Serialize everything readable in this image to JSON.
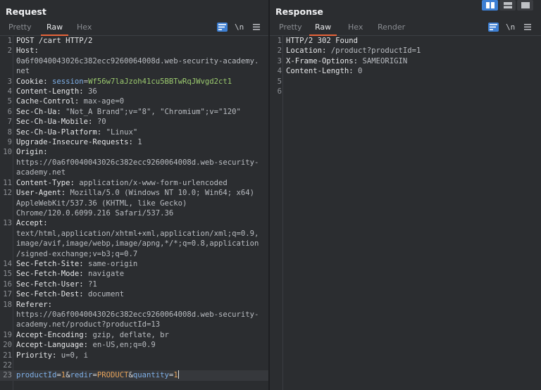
{
  "request": {
    "title": "Request",
    "tabs": [
      "Pretty",
      "Raw",
      "Hex"
    ],
    "active_tab": "Raw",
    "tools": {
      "newline": "\\n"
    },
    "lines": [
      {
        "n": "1",
        "parts": [
          {
            "t": "POST /cart HTTP/2",
            "c": "hname"
          }
        ]
      },
      {
        "n": "2",
        "parts": [
          {
            "t": "Host:",
            "c": "hname"
          }
        ]
      },
      {
        "n": "",
        "parts": [
          {
            "t": "0a6f0040043026c382ecc9260064008d.web-security-academy.",
            "c": "hval"
          }
        ]
      },
      {
        "n": "",
        "parts": [
          {
            "t": "net",
            "c": "hval"
          }
        ]
      },
      {
        "n": "3",
        "parts": [
          {
            "t": "Cookie: ",
            "c": "hname"
          },
          {
            "t": "session",
            "c": "cookie-name"
          },
          {
            "t": "=",
            "c": "hval"
          },
          {
            "t": "Wf56w7laJzoh41cu5BBTwRqJWvgd2ct1",
            "c": "cookie-val"
          }
        ]
      },
      {
        "n": "4",
        "parts": [
          {
            "t": "Content-Length:",
            "c": "hname"
          },
          {
            "t": " 36",
            "c": "hval"
          }
        ]
      },
      {
        "n": "5",
        "parts": [
          {
            "t": "Cache-Control:",
            "c": "hname"
          },
          {
            "t": " max-age=0",
            "c": "hval"
          }
        ]
      },
      {
        "n": "6",
        "parts": [
          {
            "t": "Sec-Ch-Ua:",
            "c": "hname"
          },
          {
            "t": " \"Not_A Brand\";v=\"8\", \"Chromium\";v=\"120\"",
            "c": "hval"
          }
        ]
      },
      {
        "n": "7",
        "parts": [
          {
            "t": "Sec-Ch-Ua-Mobile:",
            "c": "hname"
          },
          {
            "t": " ?0",
            "c": "hval"
          }
        ]
      },
      {
        "n": "8",
        "parts": [
          {
            "t": "Sec-Ch-Ua-Platform:",
            "c": "hname"
          },
          {
            "t": " \"Linux\"",
            "c": "hval"
          }
        ]
      },
      {
        "n": "9",
        "parts": [
          {
            "t": "Upgrade-Insecure-Requests:",
            "c": "hname"
          },
          {
            "t": " 1",
            "c": "hval"
          }
        ]
      },
      {
        "n": "10",
        "parts": [
          {
            "t": "Origin:",
            "c": "hname"
          }
        ]
      },
      {
        "n": "",
        "parts": [
          {
            "t": "https://0a6f0040043026c382ecc9260064008d.web-security-",
            "c": "hval"
          }
        ]
      },
      {
        "n": "",
        "parts": [
          {
            "t": "academy.net",
            "c": "hval"
          }
        ]
      },
      {
        "n": "11",
        "parts": [
          {
            "t": "Content-Type:",
            "c": "hname"
          },
          {
            "t": " application/x-www-form-urlencoded",
            "c": "hval"
          }
        ]
      },
      {
        "n": "12",
        "parts": [
          {
            "t": "User-Agent:",
            "c": "hname"
          },
          {
            "t": " Mozilla/5.0 (Windows NT 10.0; Win64; x64)",
            "c": "hval"
          }
        ]
      },
      {
        "n": "",
        "parts": [
          {
            "t": "AppleWebKit/537.36 (KHTML, like Gecko)",
            "c": "hval"
          }
        ]
      },
      {
        "n": "",
        "parts": [
          {
            "t": "Chrome/120.0.6099.216 Safari/537.36",
            "c": "hval"
          }
        ]
      },
      {
        "n": "13",
        "parts": [
          {
            "t": "Accept:",
            "c": "hname"
          }
        ]
      },
      {
        "n": "",
        "parts": [
          {
            "t": "text/html,application/xhtml+xml,application/xml;q=0.9,",
            "c": "hval"
          }
        ]
      },
      {
        "n": "",
        "parts": [
          {
            "t": "image/avif,image/webp,image/apng,*/*;q=0.8,application",
            "c": "hval"
          }
        ]
      },
      {
        "n": "",
        "parts": [
          {
            "t": "/signed-exchange;v=b3;q=0.7",
            "c": "hval"
          }
        ]
      },
      {
        "n": "14",
        "parts": [
          {
            "t": "Sec-Fetch-Site:",
            "c": "hname"
          },
          {
            "t": " same-origin",
            "c": "hval"
          }
        ]
      },
      {
        "n": "15",
        "parts": [
          {
            "t": "Sec-Fetch-Mode:",
            "c": "hname"
          },
          {
            "t": " navigate",
            "c": "hval"
          }
        ]
      },
      {
        "n": "16",
        "parts": [
          {
            "t": "Sec-Fetch-User:",
            "c": "hname"
          },
          {
            "t": " ?1",
            "c": "hval"
          }
        ]
      },
      {
        "n": "17",
        "parts": [
          {
            "t": "Sec-Fetch-Dest:",
            "c": "hname"
          },
          {
            "t": " document",
            "c": "hval"
          }
        ]
      },
      {
        "n": "18",
        "parts": [
          {
            "t": "Referer:",
            "c": "hname"
          }
        ]
      },
      {
        "n": "",
        "parts": [
          {
            "t": "https://0a6f0040043026c382ecc9260064008d.web-security-",
            "c": "hval"
          }
        ]
      },
      {
        "n": "",
        "parts": [
          {
            "t": "academy.net/product?productId=13",
            "c": "hval"
          }
        ]
      },
      {
        "n": "19",
        "parts": [
          {
            "t": "Accept-Encoding:",
            "c": "hname"
          },
          {
            "t": " gzip, deflate, br",
            "c": "hval"
          }
        ]
      },
      {
        "n": "20",
        "parts": [
          {
            "t": "Accept-Language:",
            "c": "hname"
          },
          {
            "t": " en-US,en;q=0.9",
            "c": "hval"
          }
        ]
      },
      {
        "n": "21",
        "parts": [
          {
            "t": "Priority:",
            "c": "hname"
          },
          {
            "t": " u=0, i",
            "c": "hval"
          }
        ]
      },
      {
        "n": "22",
        "parts": []
      },
      {
        "n": "23",
        "cursor": true,
        "parts": [
          {
            "t": "productId",
            "c": "param-name"
          },
          {
            "t": "=",
            "c": "amp"
          },
          {
            "t": "1",
            "c": "param-val"
          },
          {
            "t": "&",
            "c": "amp"
          },
          {
            "t": "redir",
            "c": "param-name"
          },
          {
            "t": "=",
            "c": "amp"
          },
          {
            "t": "PRODUCT",
            "c": "param-val"
          },
          {
            "t": "&",
            "c": "amp"
          },
          {
            "t": "quantity",
            "c": "param-name"
          },
          {
            "t": "=",
            "c": "amp"
          },
          {
            "t": "1",
            "c": "param-val"
          }
        ]
      }
    ]
  },
  "response": {
    "title": "Response",
    "tabs": [
      "Pretty",
      "Raw",
      "Hex",
      "Render"
    ],
    "active_tab": "Raw",
    "tools": {
      "newline": "\\n"
    },
    "lines": [
      {
        "n": "1",
        "parts": [
          {
            "t": "HTTP/2 302 Found",
            "c": "hname"
          }
        ]
      },
      {
        "n": "2",
        "parts": [
          {
            "t": "Location:",
            "c": "hname"
          },
          {
            "t": " /product?productId=1",
            "c": "hval"
          }
        ]
      },
      {
        "n": "3",
        "parts": [
          {
            "t": "X-Frame-Options:",
            "c": "hname"
          },
          {
            "t": " SAMEORIGIN",
            "c": "hval"
          }
        ]
      },
      {
        "n": "4",
        "parts": [
          {
            "t": "Content-Length:",
            "c": "hname"
          },
          {
            "t": " 0",
            "c": "hval"
          }
        ]
      },
      {
        "n": "5",
        "parts": []
      },
      {
        "n": "6",
        "parts": []
      }
    ]
  },
  "colors": {
    "accent_tab": "#e8643a",
    "tool_active": "#3d7fd3"
  },
  "icons": [
    "word-wrap-icon",
    "newline-icon",
    "menu-icon",
    "layout-split-columns-icon",
    "layout-split-rows-icon",
    "layout-single-icon"
  ]
}
